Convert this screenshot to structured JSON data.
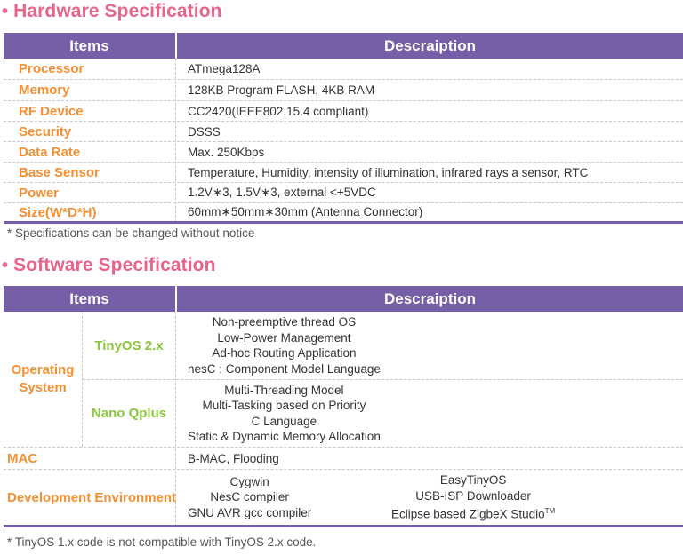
{
  "hardware": {
    "title": "Hardware Specification",
    "bullet": "•",
    "header": {
      "items": "Items",
      "description": "Descraiption"
    },
    "rows": [
      {
        "item": "Processor",
        "description": "ATmega128A"
      },
      {
        "item": "Memory",
        "description": "128KB Program FLASH, 4KB RAM"
      },
      {
        "item": "RF Device",
        "description": "CC2420(IEEE802.15.4 compliant)"
      },
      {
        "item": "Security",
        "description": "DSSS"
      },
      {
        "item": "Data Rate",
        "description": "Max. 250Kbps"
      },
      {
        "item": "Base Sensor",
        "description": "Temperature, Humidity, intensity of illumination, infrared rays a sensor, RTC"
      },
      {
        "item": "Power",
        "description": "1.2V∗3, 1.5V∗3, external <+5VDC"
      },
      {
        "item": "Size(W*D*H)",
        "description": "60mm∗50mm∗30mm (Antenna Connector)"
      }
    ],
    "note": "* Specifications can be changed without notice"
  },
  "software": {
    "title": "Software Specification",
    "bullet": "•",
    "header": {
      "items": "Items",
      "description": "Descraiption"
    },
    "operating_system": {
      "label_line1": "Operating",
      "label_line2": "System",
      "groups": [
        {
          "name": "TinyOS 2.x",
          "lines": [
            "Non-preemptive thread OS",
            "Low-Power Management",
            "Ad-hoc Routing Application",
            "nesC : Component Model Language"
          ]
        },
        {
          "name": "Nano Qplus",
          "lines": [
            "Multi-Threading Model",
            "Multi-Tasking based on Priority",
            "C Language",
            "Static & Dynamic Memory Allocation"
          ]
        }
      ]
    },
    "mac": {
      "item": "MAC",
      "description": "B-MAC, Flooding"
    },
    "dev_env": {
      "item": "Development Environment",
      "col1": [
        "Cygwin",
        "NesC compiler",
        "GNU AVR gcc compiler"
      ],
      "col2": [
        "EasyTinyOS",
        "USB-ISP Downloader",
        "Eclipse based ZigbeX Studio"
      ],
      "trademark": "TM"
    },
    "note": "* TinyOS 1.x code is not compatible with TinyOS 2.x code."
  },
  "colors": {
    "header_bg": "#775fa7",
    "title": "#e8648b",
    "item": "#f39033",
    "sub_item": "#8cc63f"
  }
}
